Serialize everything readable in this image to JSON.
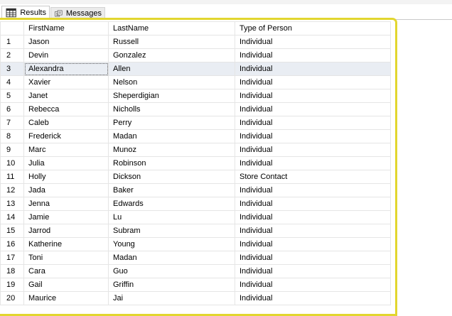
{
  "tabs": [
    {
      "label": "Results",
      "icon": "grid-icon"
    },
    {
      "label": "Messages",
      "icon": "messages-icon"
    }
  ],
  "columns": [
    "",
    "FirstName",
    "LastName",
    "Type of Person"
  ],
  "rows": [
    [
      "1",
      "Jason",
      "Russell",
      "Individual"
    ],
    [
      "2",
      "Devin",
      "Gonzalez",
      "Individual"
    ],
    [
      "3",
      "Alexandra",
      "Allen",
      "Individual"
    ],
    [
      "4",
      "Xavier",
      "Nelson",
      "Individual"
    ],
    [
      "5",
      "Janet",
      "Sheperdigian",
      "Individual"
    ],
    [
      "6",
      "Rebecca",
      "Nicholls",
      "Individual"
    ],
    [
      "7",
      "Caleb",
      "Perry",
      "Individual"
    ],
    [
      "8",
      "Frederick",
      "Madan",
      "Individual"
    ],
    [
      "9",
      "Marc",
      "Munoz",
      "Individual"
    ],
    [
      "10",
      "Julia",
      "Robinson",
      "Individual"
    ],
    [
      "11",
      "Holly",
      "Dickson",
      "Store Contact"
    ],
    [
      "12",
      "Jada",
      "Baker",
      "Individual"
    ],
    [
      "13",
      "Jenna",
      "Edwards",
      "Individual"
    ],
    [
      "14",
      "Jamie",
      "Lu",
      "Individual"
    ],
    [
      "15",
      "Jarrod",
      "Subram",
      "Individual"
    ],
    [
      "16",
      "Katherine",
      "Young",
      "Individual"
    ],
    [
      "17",
      "Toni",
      "Madan",
      "Individual"
    ],
    [
      "18",
      "Cara",
      "Guo",
      "Individual"
    ],
    [
      "19",
      "Gail",
      "Griffin",
      "Individual"
    ],
    [
      "20",
      "Maurice",
      "Jai",
      "Individual"
    ]
  ],
  "selected_row": "3",
  "colors": {
    "highlight_border": "#e2d62f",
    "selected_row_bg": "#e9edf3",
    "gridline": "#e5e5e5"
  }
}
